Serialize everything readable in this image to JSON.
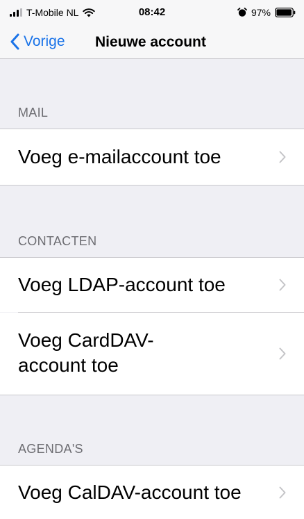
{
  "status_bar": {
    "carrier": "T-Mobile NL",
    "time": "08:42",
    "battery_percent": "97%",
    "icons": [
      "signal-icon",
      "wifi-icon",
      "alarm-icon",
      "battery-icon"
    ]
  },
  "nav": {
    "back_label": "Vorige",
    "title": "Nieuwe account",
    "accent_color": "#1a73e8"
  },
  "sections": {
    "mail": {
      "header": "MAIL",
      "items": [
        {
          "label": "Voeg e-mailaccount toe"
        }
      ]
    },
    "contacts": {
      "header": "CONTACTEN",
      "items": [
        {
          "label": "Voeg LDAP-account toe"
        },
        {
          "label": "Voeg CardDAV-\naccount toe"
        }
      ]
    },
    "calendars": {
      "header": "AGENDA'S",
      "items": [
        {
          "label": "Voeg CalDAV-account toe"
        }
      ]
    }
  }
}
